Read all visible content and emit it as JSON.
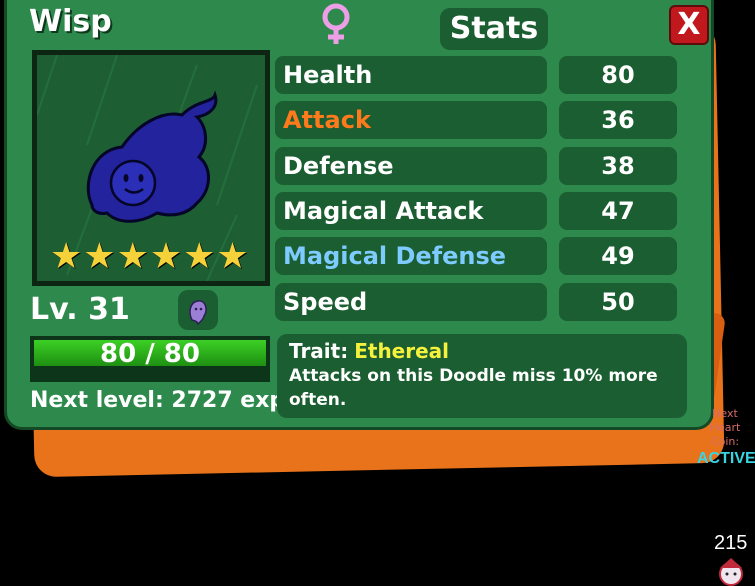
{
  "creature": {
    "name": "Wisp",
    "gender_icon": "female-symbol-icon",
    "stars": 6,
    "level_label": "Lv. 31",
    "hp_text": "80 / 80",
    "hp_fraction": 1.0,
    "xp_fraction": 0.0,
    "next_level_text": "Next level: 2727 exp",
    "type_icon": "ghost-icon"
  },
  "header": {
    "stats_title": "Stats",
    "close_label": "X"
  },
  "stats": [
    {
      "label": "Health",
      "value": "80",
      "color": "#ffffff"
    },
    {
      "label": "Attack",
      "value": "36",
      "color": "#ff7a1c"
    },
    {
      "label": "Defense",
      "value": "38",
      "color": "#ffffff"
    },
    {
      "label": "Magical Attack",
      "value": "47",
      "color": "#ffffff"
    },
    {
      "label": "Magical Defense",
      "value": "49",
      "color": "#7ecbff"
    },
    {
      "label": "Speed",
      "value": "50",
      "color": "#ffffff"
    }
  ],
  "trait": {
    "prefix": "Trait:",
    "name": "Ethereal",
    "description": "Attacks on this Doodle miss 10% more often."
  },
  "side": {
    "next_heart_label": "Next Heart Coin:",
    "active_label": "ACTIVE",
    "counter": "215"
  },
  "colors": {
    "panel": "#2e8a4c",
    "row_bg": "#1b5e31",
    "star": "#f6d23a",
    "hp_bar": "#3cd025",
    "close": "#c0181c"
  }
}
